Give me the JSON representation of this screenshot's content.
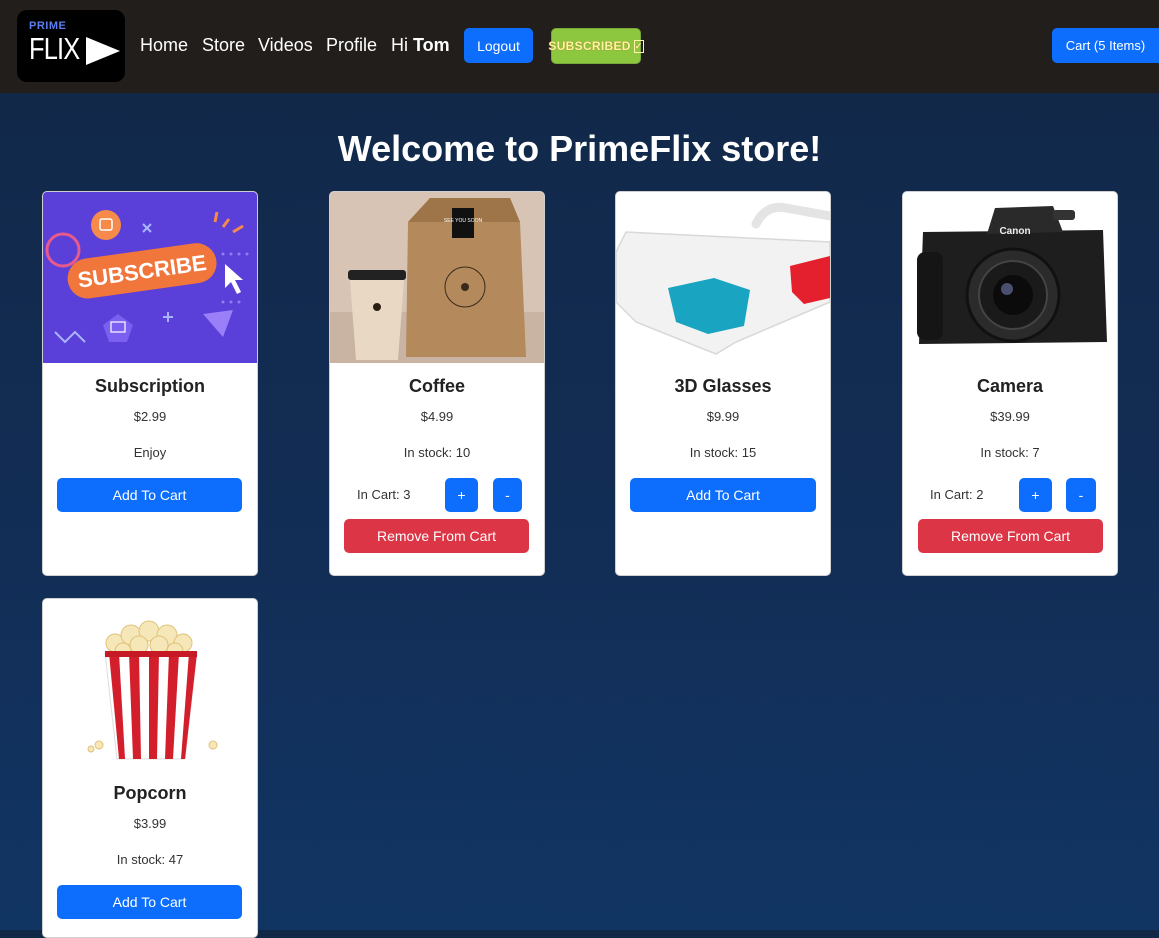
{
  "nav": {
    "logo_top": "PRIME",
    "logo_main": "FLIX",
    "links": [
      "Home",
      "Store",
      "Videos",
      "Profile"
    ],
    "greeting_prefix": "Hi",
    "user_name": "Tom",
    "logout_label": "Logout",
    "subscribed_badge": "SUBSCRIBED",
    "cart_label": "Cart (5 Items)"
  },
  "page": {
    "title": "Welcome to PrimeFlix store!"
  },
  "products": [
    {
      "name": "Subscription",
      "price": "$2.99",
      "stock_text": "Enjoy",
      "add_label": "Add To Cart",
      "image_icon": "subscribe-banner",
      "image_text": "SUBSCRIBE"
    },
    {
      "name": "Coffee",
      "price": "$4.99",
      "stock_text": "In stock: 10",
      "in_cart_text": "In Cart: 3",
      "plus_label": "+",
      "minus_label": "-",
      "remove_label": "Remove From Cart",
      "image_icon": "coffee-bag",
      "image_text": "SEE YOU SOON"
    },
    {
      "name": "3D Glasses",
      "price": "$9.99",
      "stock_text": "In stock: 15",
      "add_label": "Add To Cart",
      "image_icon": "3d-glasses"
    },
    {
      "name": "Camera",
      "price": "$39.99",
      "stock_text": "In stock: 7",
      "in_cart_text": "In Cart: 2",
      "plus_label": "+",
      "minus_label": "-",
      "remove_label": "Remove From Cart",
      "image_icon": "camera",
      "image_text": "Canon"
    },
    {
      "name": "Popcorn",
      "price": "$3.99",
      "stock_text": "In stock: 47",
      "add_label": "Add To Cart",
      "image_icon": "popcorn"
    }
  ],
  "colors": {
    "navbar": "#221e1c",
    "primary": "#0d6efd",
    "danger": "#dc3545",
    "badge": "#8dc63f"
  }
}
